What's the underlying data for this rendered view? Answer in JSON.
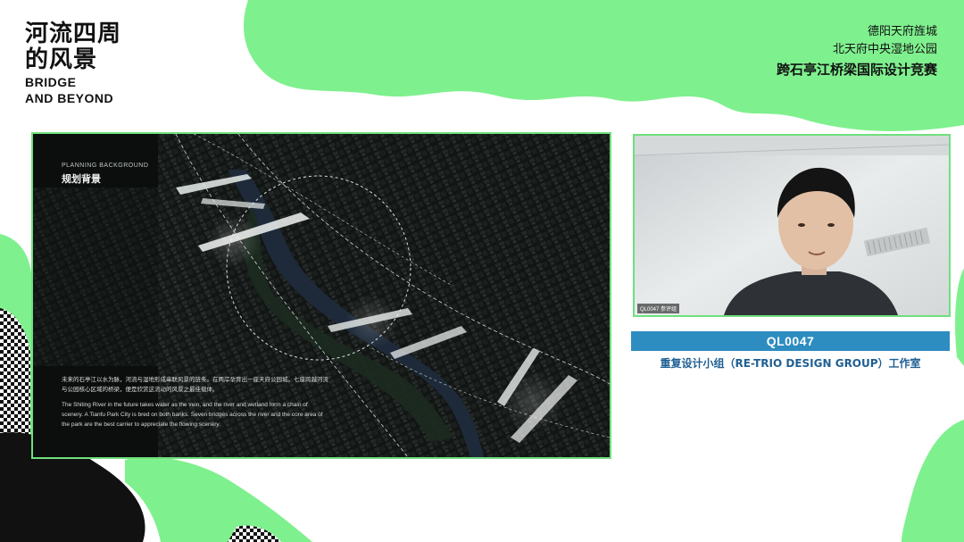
{
  "brand": {
    "title_cn_line1": "河流四周",
    "title_cn_line2": "的风景",
    "title_en_line1": "BRIDGE",
    "title_en_line2": "AND BEYOND"
  },
  "event": {
    "line1": "德阳天府旌城",
    "line2": "北天府中央湿地公园",
    "line3": "跨石亭江桥梁国际设计竞赛"
  },
  "slide": {
    "kicker": "PLANNING BACKGROUND",
    "heading": "规划背景",
    "description_cn": "未来的石亭江以水为脉，河流与湿地形成串联风景的链条。在两岸孕育出一座天府公园城。七座跨越河流与公园核心区域的桥梁，便是欣赏这流动的风景之最佳载体。",
    "description_en": "The Shiting River in the future takes water as the vein, and the river and wetland form a chain of scenery. A Tianfu Park City is bred on both banks. Seven bridges across the river and the core area of the park are the best carrier to appreciate the flowing scenery."
  },
  "camera": {
    "tag": "QL0047 参评组"
  },
  "presenter": {
    "id": "QL0047",
    "team": "重复设计小组（RE-TRIO DESIGN GROUP）工作室"
  },
  "colors": {
    "accent_green": "#7ff08e",
    "id_bar_blue": "#2d8cc0",
    "team_text_blue": "#1f5f93"
  }
}
